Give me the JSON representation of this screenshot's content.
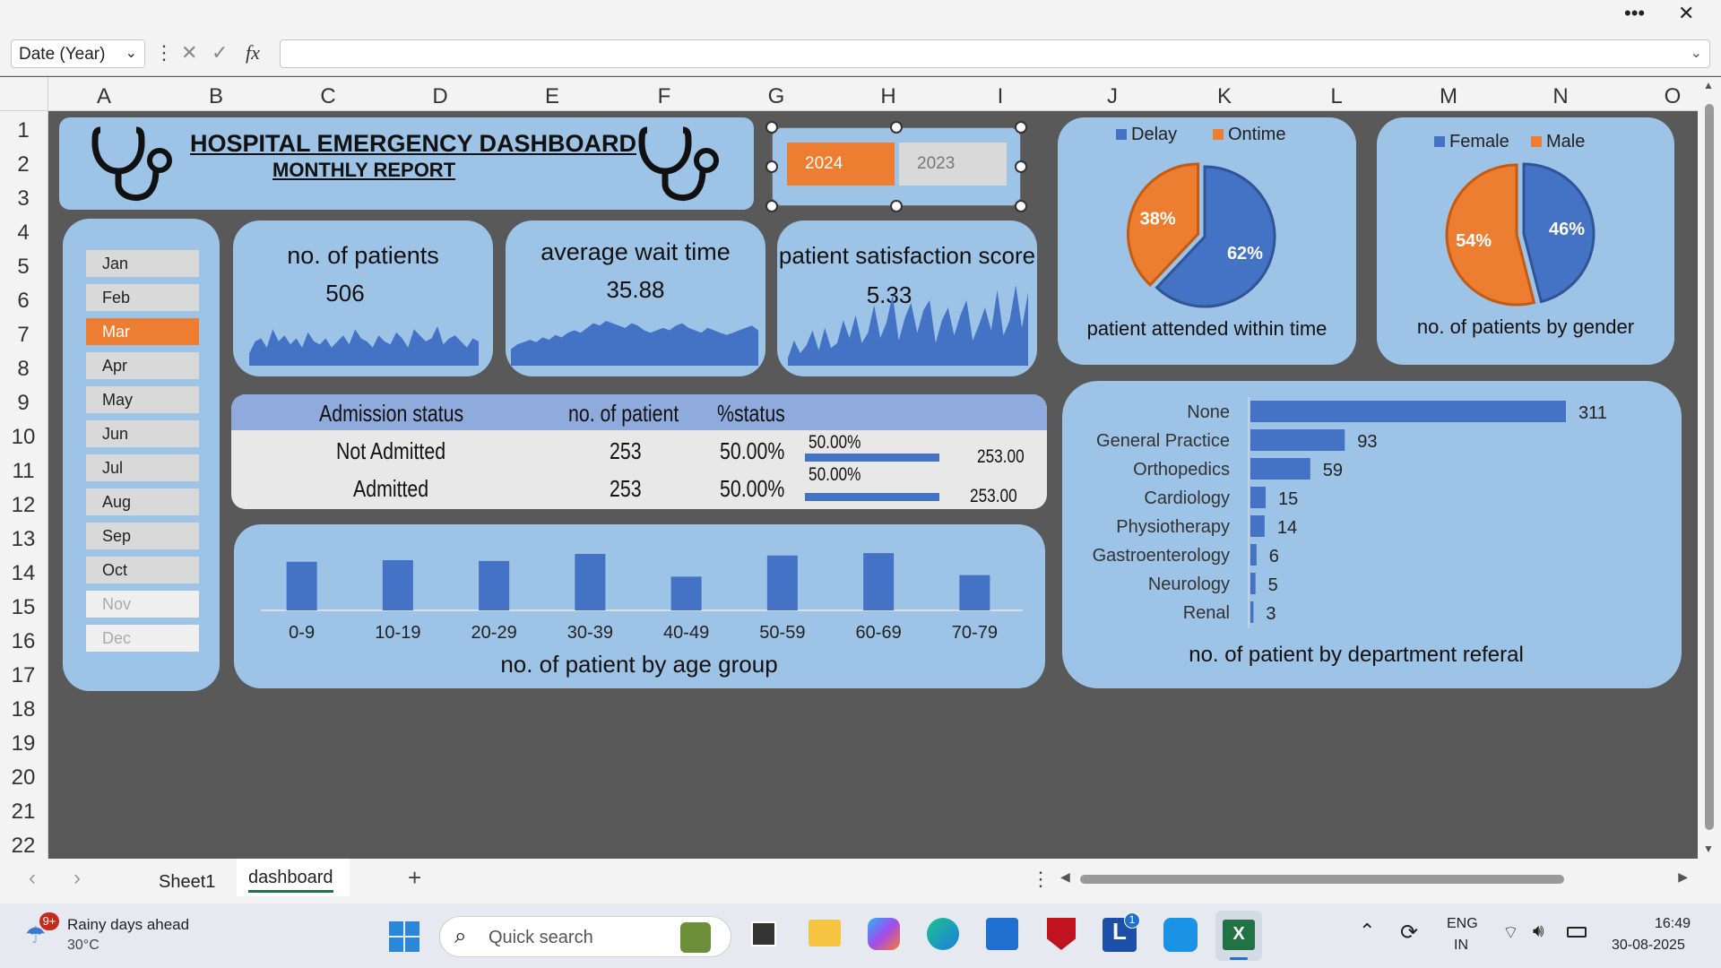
{
  "window": {
    "more_label": "•••",
    "close_label": "✕"
  },
  "formula_bar": {
    "name_box": "Date (Year)",
    "cancel_icon": "✕",
    "enter_icon": "✓",
    "fx_label": "fx",
    "formula": ""
  },
  "columns": [
    "A",
    "B",
    "C",
    "D",
    "E",
    "F",
    "G",
    "H",
    "I",
    "J",
    "K",
    "L",
    "M",
    "N",
    "O"
  ],
  "rows": [
    "1",
    "2",
    "3",
    "4",
    "5",
    "6",
    "7",
    "8",
    "9",
    "10",
    "11",
    "12",
    "13",
    "14",
    "15",
    "16",
    "17",
    "18",
    "19",
    "20",
    "21",
    "22"
  ],
  "dashboard": {
    "title": "HOSPITAL EMERGENCY DASHBOARD",
    "subtitle": "MONTHLY REPORT",
    "years": [
      {
        "label": "2024",
        "selected": true
      },
      {
        "label": "2023",
        "selected": false
      }
    ],
    "months": [
      {
        "label": "Jan",
        "state": "normal"
      },
      {
        "label": "Feb",
        "state": "normal"
      },
      {
        "label": "Mar",
        "state": "selected"
      },
      {
        "label": "Apr",
        "state": "normal"
      },
      {
        "label": "May",
        "state": "normal"
      },
      {
        "label": "Jun",
        "state": "normal"
      },
      {
        "label": "Jul",
        "state": "normal"
      },
      {
        "label": "Aug",
        "state": "normal"
      },
      {
        "label": "Sep",
        "state": "normal"
      },
      {
        "label": "Oct",
        "state": "normal"
      },
      {
        "label": "Nov",
        "state": "disabled"
      },
      {
        "label": "Dec",
        "state": "disabled"
      }
    ],
    "kpis": {
      "patients": {
        "label": "no. of patients",
        "value": "506"
      },
      "wait": {
        "label": "average wait time",
        "value": "35.88"
      },
      "satisfaction": {
        "label": "patient satisfaction score",
        "value": "5.33"
      }
    },
    "admission_table": {
      "headers": [
        "Admission status",
        "no. of patient",
        "%status"
      ],
      "rows": [
        {
          "status": "Not Admitted",
          "count": "253",
          "pct": "50.00%",
          "bar_pct_label": "50.00%",
          "bar_value_label": "253.00",
          "fraction": 0.5
        },
        {
          "status": "Admitted",
          "count": "253",
          "pct": "50.00%",
          "bar_pct_label": "50.00%",
          "bar_value_label": "253.00",
          "fraction": 0.5
        }
      ]
    },
    "colors": {
      "blue": "#4472c4",
      "orange": "#ed7d31",
      "panel": "#9dc3e6",
      "background": "#595959"
    }
  },
  "chart_data": [
    {
      "type": "pie",
      "title": "patient attended within  time",
      "categories": [
        "Delay",
        "Ontime"
      ],
      "values": [
        62,
        38
      ],
      "labels": [
        "62%",
        "38%"
      ],
      "colors": [
        "#4472c4",
        "#ed7d31"
      ],
      "legend": "top"
    },
    {
      "type": "pie",
      "title": "no. of patients by gender",
      "categories": [
        "Female",
        "Male"
      ],
      "values": [
        46,
        54
      ],
      "labels": [
        "46%",
        "54%"
      ],
      "colors": [
        "#4472c4",
        "#ed7d31"
      ],
      "legend": "top"
    },
    {
      "type": "bar",
      "title": "no. of patient by age group",
      "categories": [
        "0-9",
        "10-19",
        "20-29",
        "30-39",
        "40-49",
        "50-59",
        "60-69",
        "70-79"
      ],
      "values": [
        62,
        64,
        63,
        72,
        43,
        70,
        73,
        45
      ],
      "ylim": [
        0,
        80
      ]
    },
    {
      "type": "bar",
      "orientation": "horizontal",
      "title": "no. of patient by department referal",
      "categories": [
        "None",
        "General Practice",
        "Orthopedics",
        "Cardiology",
        "Physiotherapy",
        "Gastroenterology",
        "Neurology",
        "Renal"
      ],
      "values": [
        311,
        93,
        59,
        15,
        14,
        6,
        5,
        3
      ]
    },
    {
      "type": "area",
      "title": "no. of patients",
      "values": [
        4,
        8,
        9,
        6,
        12,
        8,
        10,
        7,
        9,
        6,
        11,
        8,
        7,
        9,
        6,
        8,
        10,
        7,
        12,
        9,
        8,
        6,
        10,
        8,
        7,
        11,
        9,
        6,
        12,
        10,
        8,
        9,
        13,
        7,
        9,
        10,
        8,
        6,
        9,
        8
      ]
    },
    {
      "type": "area",
      "title": "average wait time",
      "values": [
        7,
        9,
        10,
        11,
        10,
        12,
        11,
        13,
        12,
        14,
        15,
        14,
        16,
        18,
        17,
        19,
        18,
        17,
        16,
        18,
        17,
        15,
        14,
        15,
        16,
        15,
        17,
        18,
        16,
        15,
        14,
        16,
        15,
        14,
        13,
        14,
        15,
        16,
        17,
        15
      ]
    },
    {
      "type": "area",
      "title": "patient satisfaction score",
      "values": [
        6,
        20,
        10,
        16,
        28,
        12,
        30,
        14,
        18,
        36,
        22,
        40,
        18,
        26,
        48,
        22,
        34,
        56,
        20,
        38,
        50,
        26,
        44,
        52,
        18,
        36,
        46,
        24,
        40,
        52,
        20,
        32,
        46,
        28,
        60,
        24,
        36,
        64,
        30,
        58
      ]
    }
  ],
  "sheets": {
    "tabs": [
      "Sheet1",
      "dashboard"
    ],
    "active": "dashboard",
    "add_label": "+"
  },
  "taskbar": {
    "weather_badge": "9+",
    "weather_title": "Rainy days ahead",
    "weather_temp": "30°C",
    "search_placeholder": "Quick search",
    "lang": "ENG",
    "region": "IN",
    "time": "16:49",
    "date": "30-08-2025",
    "notification_badge": "1"
  }
}
